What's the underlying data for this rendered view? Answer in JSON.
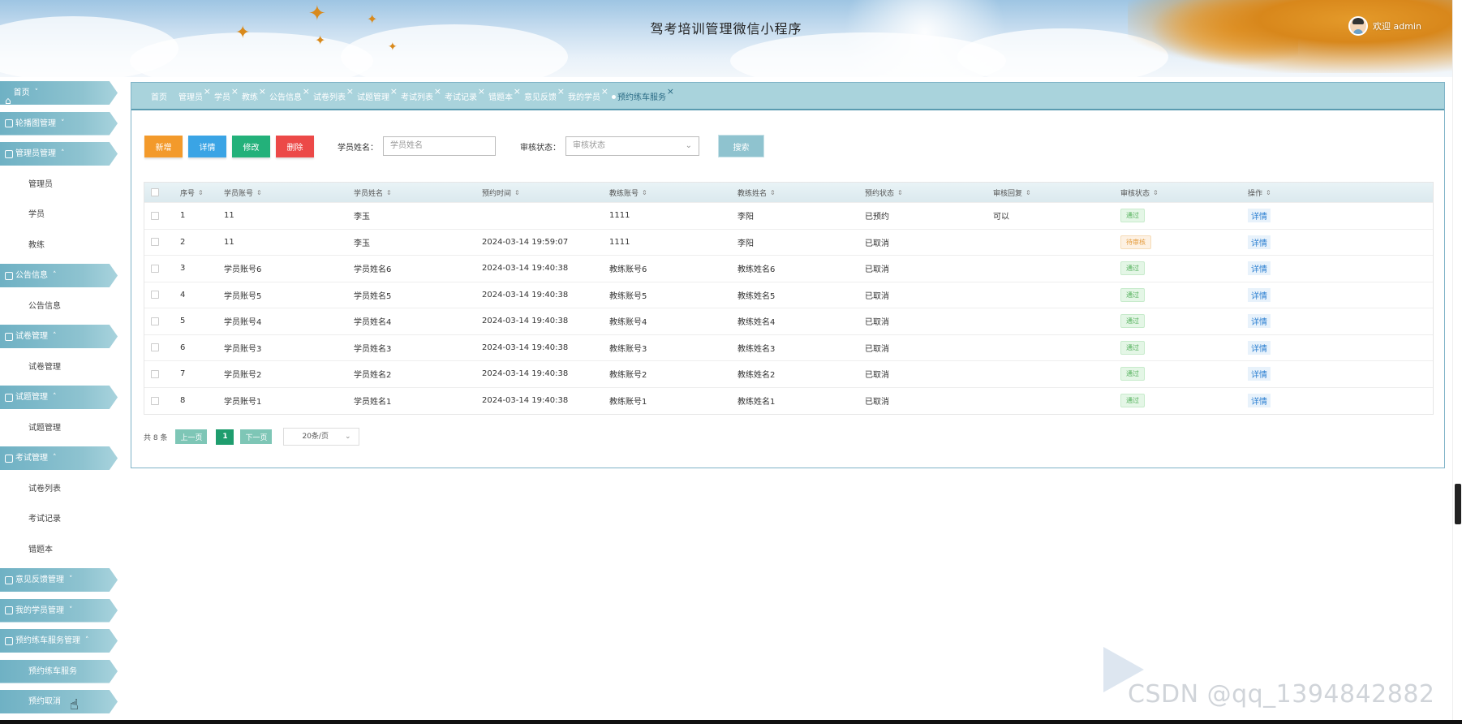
{
  "header": {
    "title": "驾考培训管理微信小程序",
    "welcome": "欢迎 admin"
  },
  "sidebar": {
    "items": [
      {
        "type": "group",
        "label": "首页",
        "chev": "˅",
        "icon": "home-icon"
      },
      {
        "type": "group",
        "label": "轮播图管理",
        "chev": "˅",
        "icon": "grid-icon"
      },
      {
        "type": "group",
        "label": "管理员管理",
        "chev": "˄",
        "icon": "car-icon"
      },
      {
        "type": "sub",
        "label": "管理员"
      },
      {
        "type": "sub",
        "label": "学员"
      },
      {
        "type": "sub",
        "label": "教练"
      },
      {
        "type": "group",
        "label": "公告信息",
        "chev": "˄",
        "icon": "grid-icon"
      },
      {
        "type": "sub",
        "label": "公告信息"
      },
      {
        "type": "group",
        "label": "试卷管理",
        "chev": "˄",
        "icon": "clock-icon"
      },
      {
        "type": "sub",
        "label": "试卷管理"
      },
      {
        "type": "group",
        "label": "试题管理",
        "chev": "˄",
        "icon": "edit-icon"
      },
      {
        "type": "sub",
        "label": "试题管理"
      },
      {
        "type": "group",
        "label": "考试管理",
        "chev": "˄",
        "icon": "grid-icon"
      },
      {
        "type": "sub",
        "label": "试卷列表"
      },
      {
        "type": "sub",
        "label": "考试记录"
      },
      {
        "type": "sub",
        "label": "错题本"
      },
      {
        "type": "group",
        "label": "意见反馈管理",
        "chev": "˅",
        "icon": "doc-icon"
      },
      {
        "type": "group",
        "label": "我的学员管理",
        "chev": "˅",
        "icon": "grid-icon"
      },
      {
        "type": "group",
        "label": "预约练车服务管理",
        "chev": "˄",
        "icon": "car-icon"
      },
      {
        "type": "sub",
        "label": "预约练车服务",
        "active": true
      },
      {
        "type": "sub",
        "label": "预约取消",
        "active": true
      }
    ]
  },
  "tabs": [
    {
      "label": "首页",
      "close": false
    },
    {
      "label": "管理员",
      "close": true
    },
    {
      "label": "学员",
      "close": true
    },
    {
      "label": "教练",
      "close": true
    },
    {
      "label": "公告信息",
      "close": true
    },
    {
      "label": "试卷列表",
      "close": true
    },
    {
      "label": "试题管理",
      "close": true
    },
    {
      "label": "考试列表",
      "close": true
    },
    {
      "label": "考试记录",
      "close": true
    },
    {
      "label": "错题本",
      "close": true
    },
    {
      "label": "意见反馈",
      "close": true
    },
    {
      "label": "我的学员",
      "close": true
    },
    {
      "label": "预约练车服务",
      "close": true,
      "active": true
    }
  ],
  "toolbar": {
    "add": "新增",
    "detail": "详情",
    "edit": "修改",
    "delete": "删除",
    "name_label": "学员姓名：",
    "name_placeholder": "学员姓名",
    "status_label": "审核状态：",
    "status_placeholder": "审核状态",
    "search": "搜索"
  },
  "table": {
    "columns": [
      "序号",
      "学员账号",
      "学员姓名",
      "预约时间",
      "教练账号",
      "教练姓名",
      "预约状态",
      "审核回复",
      "审核状态",
      "操作"
    ],
    "rows": [
      {
        "no": "1",
        "account": "11",
        "name": "李玉",
        "time": "",
        "coach_account": "1111",
        "coach_name": "李阳",
        "status": "已预约",
        "reply": "可以",
        "audit": "通过",
        "audit_type": "ok",
        "action": "详情"
      },
      {
        "no": "2",
        "account": "11",
        "name": "李玉",
        "time": "2024-03-14 19:59:07",
        "coach_account": "1111",
        "coach_name": "李阳",
        "status": "已取消",
        "reply": "",
        "audit": "待审核",
        "audit_type": "wait",
        "action": "详情"
      },
      {
        "no": "3",
        "account": "学员账号6",
        "name": "学员姓名6",
        "time": "2024-03-14 19:40:38",
        "coach_account": "教练账号6",
        "coach_name": "教练姓名6",
        "status": "已取消",
        "reply": "",
        "audit": "通过",
        "audit_type": "ok",
        "action": "详情"
      },
      {
        "no": "4",
        "account": "学员账号5",
        "name": "学员姓名5",
        "time": "2024-03-14 19:40:38",
        "coach_account": "教练账号5",
        "coach_name": "教练姓名5",
        "status": "已取消",
        "reply": "",
        "audit": "通过",
        "audit_type": "ok",
        "action": "详情"
      },
      {
        "no": "5",
        "account": "学员账号4",
        "name": "学员姓名4",
        "time": "2024-03-14 19:40:38",
        "coach_account": "教练账号4",
        "coach_name": "教练姓名4",
        "status": "已取消",
        "reply": "",
        "audit": "通过",
        "audit_type": "ok",
        "action": "详情"
      },
      {
        "no": "6",
        "account": "学员账号3",
        "name": "学员姓名3",
        "time": "2024-03-14 19:40:38",
        "coach_account": "教练账号3",
        "coach_name": "教练姓名3",
        "status": "已取消",
        "reply": "",
        "audit": "通过",
        "audit_type": "ok",
        "action": "详情"
      },
      {
        "no": "7",
        "account": "学员账号2",
        "name": "学员姓名2",
        "time": "2024-03-14 19:40:38",
        "coach_account": "教练账号2",
        "coach_name": "教练姓名2",
        "status": "已取消",
        "reply": "",
        "audit": "通过",
        "audit_type": "ok",
        "action": "详情"
      },
      {
        "no": "8",
        "account": "学员账号1",
        "name": "学员姓名1",
        "time": "2024-03-14 19:40:38",
        "coach_account": "教练账号1",
        "coach_name": "教练姓名1",
        "status": "已取消",
        "reply": "",
        "audit": "通过",
        "audit_type": "ok",
        "action": "详情"
      }
    ]
  },
  "pager": {
    "total": "共 8 条",
    "prev": "上一页",
    "current": "1",
    "next": "下一页",
    "page_size": "20条/页"
  },
  "watermark": "CSDN @qq_1394842882"
}
